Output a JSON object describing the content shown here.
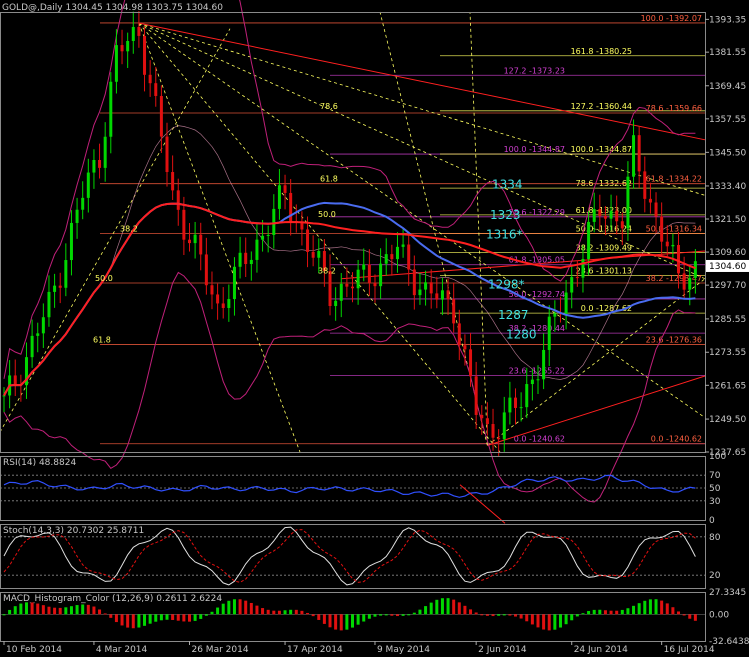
{
  "header": {
    "symbol": "GOLD@,Daily",
    "ohlc": "1304.45 1304.98 1303.75 1304.60",
    "current_price": "1304.60"
  },
  "colors": {
    "background": "#000000",
    "up_candle": "#00d800",
    "down_candle": "#e01010",
    "ma_red": "#ff2020",
    "ma_blue": "#4a6cf0",
    "bollinger": "#c0207a",
    "fib_yellow": "#ffff60",
    "fib_magenta": "#d040d0",
    "fib_red": "#ff4040",
    "cyan_labels": "#40e0e0",
    "indicator_line": "#3050ff"
  },
  "chart_data": [
    {
      "type": "candlestick",
      "title": "GOLD@,Daily",
      "x_tick_labels": [
        "10 Feb 2014",
        "4 Mar 2014",
        "26 Mar 2014",
        "17 Apr 2014",
        "9 May 2014",
        "2 Jun 2014",
        "24 Jun 2014",
        "16 Jul 2014"
      ],
      "y_tick_labels": [
        "1393.35",
        "1381.55",
        "1369.45",
        "1357.55",
        "1345.50",
        "1333.40",
        "1321.50",
        "1309.60",
        "1297.70",
        "1285.55",
        "1273.55",
        "1261.65",
        "1249.50",
        "1237.65"
      ],
      "ylim": [
        1237.65,
        1396.0
      ],
      "approx_path": {
        "x_index": [
          0,
          8,
          14,
          17,
          20,
          24,
          30,
          38,
          44,
          50,
          58,
          64,
          70,
          75,
          80,
          84,
          86,
          92,
          100,
          106,
          110,
          112,
          116,
          120,
          123
        ],
        "close": [
          1255,
          1290,
          1330,
          1345,
          1380,
          1390,
          1330,
          1290,
          1310,
          1330,
          1295,
          1300,
          1310,
          1295,
          1290,
          1252,
          1245,
          1255,
          1295,
          1325,
          1322,
          1345,
          1322,
          1300,
          1304.6
        ]
      },
      "fib_levels_right": [
        {
          "label": "100.0 -1392.07",
          "value": 1392.07,
          "color": "#ff6040"
        },
        {
          "label": "161.8 -1380.25",
          "value": 1380.25,
          "color": "#ffff60"
        },
        {
          "label": "127.2 -1373.23",
          "value": 1373.23,
          "color": "#d040d0"
        },
        {
          "label": "127.2 -1360.44",
          "value": 1360.44,
          "color": "#ffff60"
        },
        {
          "label": "78.6 -1359.66",
          "value": 1359.66,
          "color": "#ff6040"
        },
        {
          "label": "100.0 -1344.87",
          "value": 1344.87,
          "color": "#d040d0"
        },
        {
          "label": "100.0 -1344.87",
          "value": 1344.87,
          "color": "#ffff60"
        },
        {
          "label": "78.6 -1332.62",
          "value": 1332.62,
          "color": "#ffff60"
        },
        {
          "label": "61.8 -1334.22",
          "value": 1334.22,
          "color": "#ff6040"
        },
        {
          "label": "61.8 -1323.00",
          "value": 1323.0,
          "color": "#ffff60"
        },
        {
          "label": "78.6 -1322.29",
          "value": 1322.29,
          "color": "#d040d0"
        },
        {
          "label": "50.0 -1316.24",
          "value": 1316.24,
          "color": "#ffff60"
        },
        {
          "label": "50.0 -1316.34",
          "value": 1316.34,
          "color": "#ff6040"
        },
        {
          "label": "38.2 -1309.49",
          "value": 1309.49,
          "color": "#ffff60"
        },
        {
          "label": "61.8 -1305.05",
          "value": 1305.05,
          "color": "#d040d0"
        },
        {
          "label": "23.6 -1301.13",
          "value": 1301.13,
          "color": "#ffff60"
        },
        {
          "label": "38.2 -1298.47",
          "value": 1298.47,
          "color": "#ff6040"
        },
        {
          "label": "50.0 -1292.74",
          "value": 1292.74,
          "color": "#d040d0"
        },
        {
          "label": "0.0 -1287.62",
          "value": 1287.62,
          "color": "#ffff60"
        },
        {
          "label": "38.2 -1280.44",
          "value": 1280.44,
          "color": "#d040d0"
        },
        {
          "label": "23.6 -1276.36",
          "value": 1276.36,
          "color": "#ff6040"
        },
        {
          "label": "23.6 -1265.22",
          "value": 1265.22,
          "color": "#d040d0"
        },
        {
          "label": "0.0 -1240.62",
          "value": 1240.62,
          "color": "#d040d0"
        },
        {
          "label": "0.0 -1240.62",
          "value": 1240.62,
          "color": "#ff6040"
        }
      ],
      "fan_labels": [
        {
          "text": "78.6",
          "value": 1360.44
        },
        {
          "text": "61.8",
          "value": 1334.22
        },
        {
          "text": "50.0",
          "value": 1321.5
        },
        {
          "text": "38.2",
          "value": 1316.34
        },
        {
          "text": "38.2",
          "value": 1301.13
        },
        {
          "text": "50.0",
          "value": 1298.47
        },
        {
          "text": "61.8",
          "value": 1276.36
        }
      ],
      "cyan_labels": [
        {
          "text": "1334",
          "value": 1334.0
        },
        {
          "text": "1323",
          "value": 1323.0
        },
        {
          "text": "1316*",
          "value": 1316.0
        },
        {
          "text": "1298*",
          "value": 1298.0
        },
        {
          "text": "1287",
          "value": 1287.0
        },
        {
          "text": "1280",
          "value": 1280.0
        }
      ]
    },
    {
      "type": "line",
      "title": "RSI(14) 48.8824",
      "y_tick_labels": [
        "100",
        "70",
        "50",
        "30",
        "0"
      ],
      "ylim": [
        0,
        100
      ],
      "levels": [
        70,
        50,
        30
      ],
      "approx_values": [
        55,
        60,
        52,
        48,
        55,
        50,
        46,
        52,
        48,
        50,
        45,
        50,
        48,
        47,
        42,
        40,
        38,
        45,
        60,
        65,
        62,
        68,
        58,
        45,
        48.88
      ]
    },
    {
      "type": "line",
      "title": "Stoch(14,3,3) 20.7302 25.8711",
      "y_tick_labels": [
        "80",
        "20"
      ],
      "ylim": [
        0,
        100
      ],
      "levels": [
        80,
        20
      ],
      "main": [
        20.7302
      ],
      "signal": [
        25.8711
      ]
    },
    {
      "type": "bar",
      "title": "MACD_Histogram_Color (12,26,9)  0.2611  2.6224",
      "y_tick_labels": [
        "27.3345",
        "0.00",
        "-32.6438"
      ],
      "ylim": [
        -32.6438,
        27.3345
      ],
      "values_last": [
        0.2611,
        2.6224
      ]
    }
  ]
}
